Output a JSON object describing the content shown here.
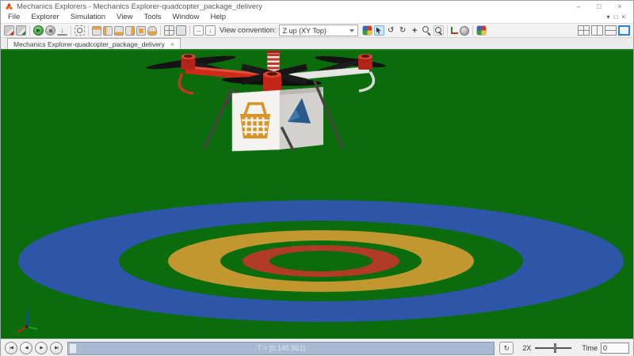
{
  "window": {
    "title": "Mechanics Explorers - Mechanics Explorer-quadcopter_package_delivery",
    "controls": [
      {
        "name": "minimize-button",
        "glyph": "–"
      },
      {
        "name": "maximize-button",
        "glyph": "□"
      },
      {
        "name": "close-button",
        "glyph": "×"
      }
    ]
  },
  "menubar": {
    "items": [
      "File",
      "Explorer",
      "Simulation",
      "View",
      "Tools",
      "Window",
      "Help"
    ],
    "child_controls": [
      {
        "name": "dock-icon",
        "glyph": "▾"
      },
      {
        "name": "undock-icon",
        "glyph": "□"
      },
      {
        "name": "close-child-icon",
        "glyph": "×"
      }
    ]
  },
  "toolbar": {
    "left_icons": [
      {
        "name": "save-explorer-config-icon",
        "cls": "i-save i-save-red"
      },
      {
        "name": "load-explorer-config-icon",
        "cls": "i-save i-save-green"
      },
      {
        "cls": "sep"
      },
      {
        "name": "play-icon",
        "cls": "i-play",
        "glyph": "▶"
      },
      {
        "name": "stop-icon",
        "cls": "i-stop"
      },
      {
        "name": "step-icon",
        "cls": "i-step",
        "glyph": "↓"
      },
      {
        "cls": "sep"
      },
      {
        "name": "zoom-to-fit-icon",
        "cls": "i-fit"
      },
      {
        "cls": "sep"
      },
      {
        "name": "view-isometric-icon",
        "cls": "i-cube c-top"
      },
      {
        "name": "view-front-icon",
        "cls": "i-cube c-left"
      },
      {
        "name": "view-top-icon",
        "cls": "i-cube c-bottom"
      },
      {
        "name": "view-side-icon",
        "cls": "i-cube c-right"
      },
      {
        "name": "view-back-icon",
        "cls": "i-cube c-front"
      },
      {
        "name": "view-custom-icon",
        "cls": "i-bucket"
      },
      {
        "cls": "sep"
      },
      {
        "name": "split-view-grid-icon",
        "cls": "i-grid4"
      },
      {
        "name": "single-view-icon",
        "cls": "i-pane"
      },
      {
        "cls": "sep"
      },
      {
        "name": "camera-forward-icon",
        "cls": "i-box-arrow",
        "glyph": "→"
      },
      {
        "name": "camera-down-icon",
        "cls": "i-box-arrow",
        "glyph": "↓"
      }
    ],
    "view_convention_label": "View convention:",
    "view_convention_value": "Z up (XY Top)",
    "right_icons": [
      {
        "name": "render-settings-icon",
        "cls": "i-rainbow"
      },
      {
        "name": "pointer-tool-icon",
        "cls": "i-pointer sel"
      },
      {
        "name": "orbit-tool-icon",
        "cls": "i-tool",
        "glyph": "↺"
      },
      {
        "name": "rotate-tool-icon",
        "cls": "i-tool",
        "glyph": "↻"
      },
      {
        "name": "pan-tool-icon",
        "cls": "i-tool i-pan",
        "glyph": "+"
      },
      {
        "name": "zoom-tool-icon",
        "cls": "i-mag"
      },
      {
        "name": "zoom-region-tool-icon",
        "cls": "i-mag i-mag-rect"
      },
      {
        "cls": "sep"
      },
      {
        "name": "show-frames-icon",
        "cls": "i-axes"
      },
      {
        "name": "show-com-icon",
        "cls": "i-globe"
      },
      {
        "cls": "sep"
      },
      {
        "name": "visual-settings-icon",
        "cls": "i-rainbow"
      }
    ],
    "layout_icons": [
      {
        "name": "layout-four-pane-icon",
        "cls": "il il-4"
      },
      {
        "name": "layout-two-vertical-icon",
        "cls": "il il-2v"
      },
      {
        "name": "layout-two-horizontal-icon",
        "cls": "il il-2h"
      },
      {
        "name": "layout-single-pane-icon",
        "cls": "il il-1 sel"
      }
    ]
  },
  "tabbar": {
    "active_tab": "Mechanics Explorer-quadcopter_package_delivery",
    "close_glyph": "×"
  },
  "statusbar": {
    "playback": [
      {
        "name": "go-to-start-button",
        "glyph": "|◀"
      },
      {
        "name": "step-back-button",
        "glyph": "◀"
      },
      {
        "name": "play-button",
        "glyph": "▶"
      },
      {
        "name": "step-forward-button",
        "glyph": "▶|"
      }
    ],
    "time_range": "T = [0,145.861]",
    "loop_glyph": "↻",
    "speed_label": "2X",
    "time_label": "Time",
    "time_value": "0"
  },
  "scene": {
    "colors": {
      "ground": "#0a6c0a",
      "ring_blue": "#2d55a8",
      "ring_gold": "#c2972f",
      "ring_red": "#b23b27",
      "arm_red": "#ce2a19",
      "package_front": "#f5f3ef",
      "basket_orange": "#d89428",
      "logo_blue": "#2a5a8c"
    }
  }
}
